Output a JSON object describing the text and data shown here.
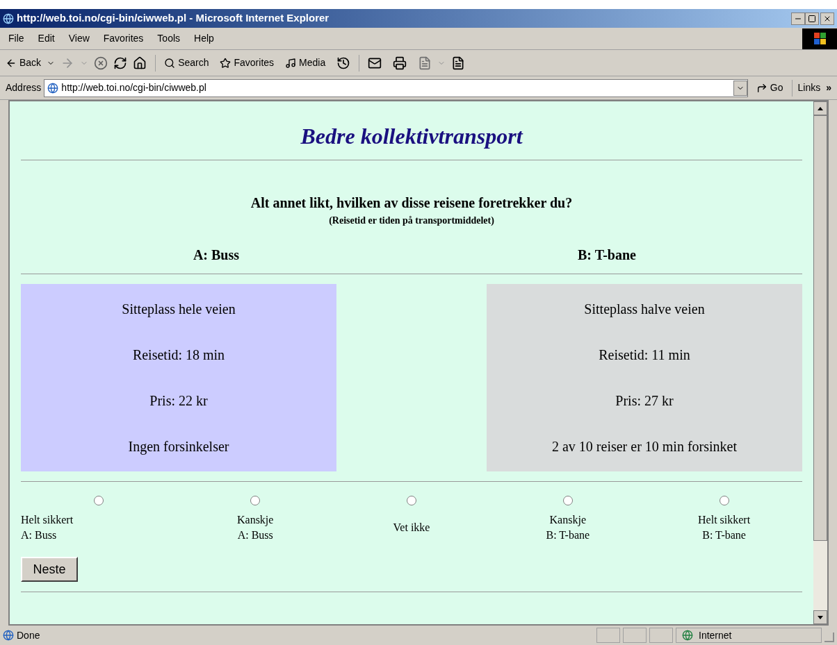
{
  "window": {
    "title": "http://web.toi.no/cgi-bin/ciwweb.pl - Microsoft Internet Explorer"
  },
  "menu": [
    "File",
    "Edit",
    "View",
    "Favorites",
    "Tools",
    "Help"
  ],
  "toolbar": {
    "back": "Back",
    "search": "Search",
    "favorites": "Favorites",
    "media": "Media"
  },
  "address_bar": {
    "label": "Address",
    "url": "http://web.toi.no/cgi-bin/ciwweb.pl",
    "go": "Go",
    "links": "Links",
    "more": "»"
  },
  "page": {
    "heading": "Bedre kollektivtransport",
    "question": "Alt annet likt, hvilken av disse reisene foretrekker du?",
    "note": "(Reisetid er tiden på transportmiddelet)",
    "options": [
      {
        "label": "A: Buss",
        "color": "#ccccff",
        "attributes": [
          "Sitteplass hele veien",
          "Reisetid: 18 min",
          "Pris: 22 kr",
          "Ingen forsinkelser"
        ]
      },
      {
        "label": "B: T-bane",
        "color": "#d9dcdc",
        "attributes": [
          "Sitteplass halve veien",
          "Reisetid: 11 min",
          "Pris: 27 kr",
          "2 av 10 reiser er 10 min forsinket"
        ]
      }
    ],
    "choices": [
      {
        "lines": [
          "Helt sikkert",
          "A: Buss"
        ],
        "selected": false
      },
      {
        "lines": [
          "Kanskje",
          "A: Buss"
        ],
        "selected": false
      },
      {
        "lines": [
          "Vet ikke"
        ],
        "selected": false
      },
      {
        "lines": [
          "Kanskje",
          "B: T-bane"
        ],
        "selected": false
      },
      {
        "lines": [
          "Helt sikkert",
          "B: T-bane"
        ],
        "selected": false
      }
    ],
    "next_button": "Neste"
  },
  "status_bar": {
    "text": "Done",
    "zone": "Internet"
  }
}
